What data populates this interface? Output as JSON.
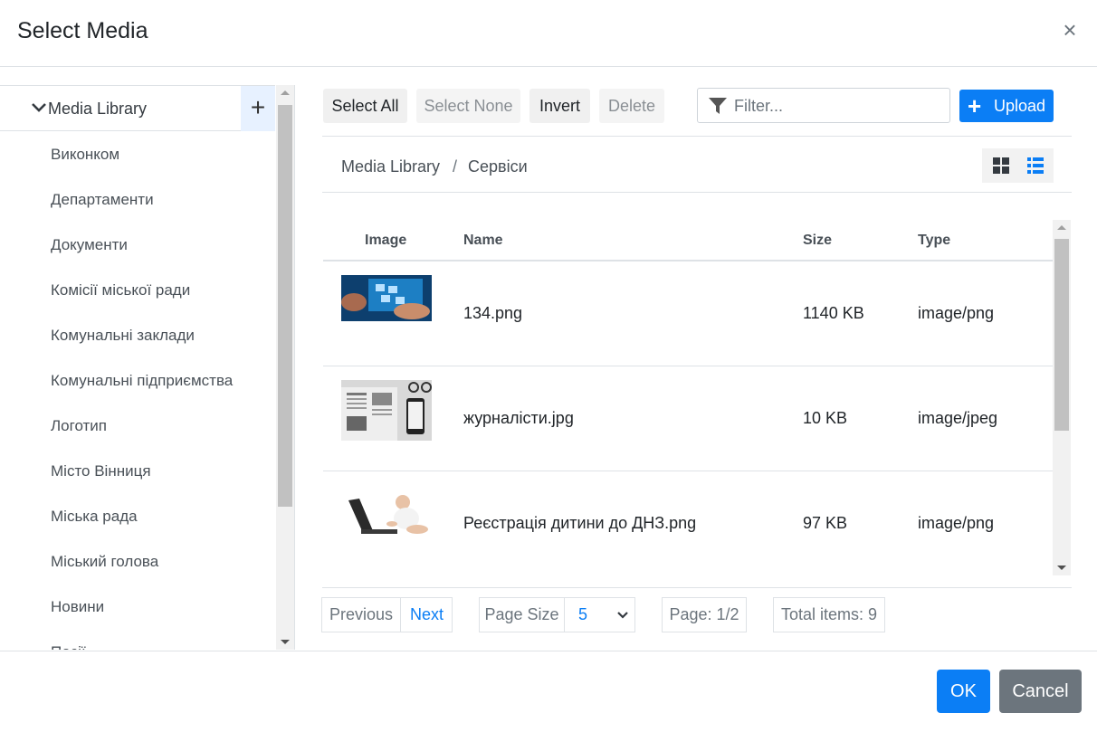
{
  "dialog": {
    "title": "Select Media",
    "close_label": "×"
  },
  "tree": {
    "root_label": "Media Library",
    "add_label": "+",
    "items": [
      "Виконком",
      "Департаменти",
      "Документи",
      "Комісії міської ради",
      "Комунальні заклади",
      "Комунальні підприємства",
      "Логотип",
      "Місто Вінниця",
      "Міська рада",
      "Міський голова",
      "Новини",
      "Посії"
    ]
  },
  "toolbar": {
    "select_all": "Select All",
    "select_none": "Select None",
    "invert": "Invert",
    "delete": "Delete",
    "filter_placeholder": "Filter...",
    "upload": "Upload"
  },
  "breadcrumb": {
    "root": "Media Library",
    "separator": "/",
    "current": "Сервіси"
  },
  "table": {
    "headers": {
      "image": "Image",
      "name": "Name",
      "size": "Size",
      "type": "Type"
    },
    "rows": [
      {
        "name": "134.png",
        "size": "1140 KB",
        "type": "image/png"
      },
      {
        "name": "журналісти.jpg",
        "size": "10 KB",
        "type": "image/jpeg"
      },
      {
        "name": "Реєстрація дитини до ДНЗ.png",
        "size": "97 KB",
        "type": "image/png"
      }
    ]
  },
  "pager": {
    "previous": "Previous",
    "next": "Next",
    "page_size_label": "Page Size",
    "page_size_value": "5",
    "page": "Page: 1/2",
    "total": "Total items: 9"
  },
  "footer": {
    "ok": "OK",
    "cancel": "Cancel"
  },
  "colors": {
    "primary": "#0b7ef5",
    "secondary": "#6c757d",
    "border": "#dee2e6"
  }
}
